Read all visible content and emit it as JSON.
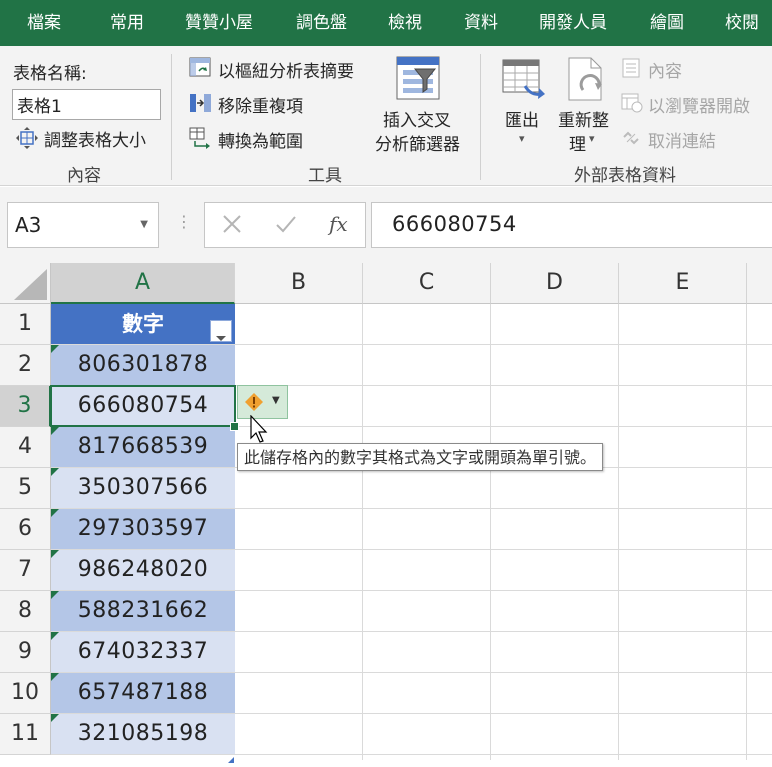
{
  "ribbon_tabs": [
    "檔案",
    "常用",
    "贊贊小屋",
    "調色盤",
    "檢視",
    "資料",
    "開發人員",
    "繪圖",
    "校閱"
  ],
  "ribbon": {
    "properties": {
      "table_name_label": "表格名稱:",
      "table_name_value": "表格1",
      "resize_table": "調整表格大小",
      "group_label": "內容"
    },
    "tools": {
      "summarize_pivot": "以樞紐分析表摘要",
      "remove_duplicates": "移除重複項",
      "convert_to_range": "轉換為範圍",
      "insert_slicer_line1": "插入交叉",
      "insert_slicer_line2": "分析篩選器",
      "group_label": "工具"
    },
    "external": {
      "export": "匯出",
      "refresh_line1": "重新整",
      "refresh_line2": "理",
      "properties": "內容",
      "open_in_browser": "以瀏覽器開啟",
      "unlink": "取消連結",
      "group_label": "外部表格資料"
    }
  },
  "formula_bar": {
    "name_box": "A3",
    "formula": "666080754",
    "fx_label": "fx"
  },
  "grid": {
    "columns": [
      "A",
      "B",
      "C",
      "D",
      "E"
    ],
    "rows": [
      "1",
      "2",
      "3",
      "4",
      "5",
      "6",
      "7",
      "8",
      "9",
      "10",
      "11"
    ],
    "selected_cell": "A3"
  },
  "table": {
    "header": "數字",
    "values": [
      "806301878",
      "666080754",
      "817668539",
      "350307566",
      "297303597",
      "986248020",
      "588231662",
      "674032337",
      "657487188",
      "321085198"
    ]
  },
  "error_tooltip": "此儲存格內的數字其格式為文字或開頭為單引號。",
  "colors": {
    "accent": "#217346",
    "table_header": "#4472c4",
    "band_dark": "#b4c6e7",
    "band_light": "#d9e1f2",
    "warning": "#f0a030"
  }
}
